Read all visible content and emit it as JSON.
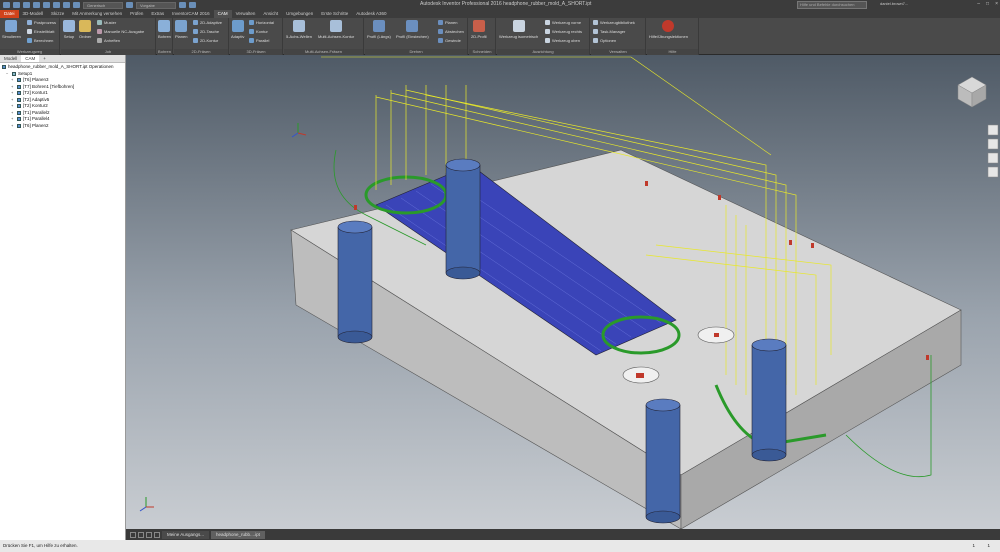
{
  "titlebar": {
    "style_value": "Generisch",
    "default_value": "Vorgabe",
    "title": "Autodesk Inventor Professional 2016    headphone_rubber_mold_A_SHORT.ipt",
    "search_placeholder": "Hilfe und Befehle durchsuchen",
    "user": "daniel.brown7...",
    "controls": [
      "–",
      "□",
      "×"
    ]
  },
  "tabs": [
    "Datei",
    "3D-Modell",
    "Skizze",
    "Mit Anmerkung versehen",
    "Prüfen",
    "Extras",
    "InventorCAM 2016",
    "CAM",
    "Verwalten",
    "Ansicht",
    "Umgebungen",
    "Erste Schritte",
    "Autodesk A360"
  ],
  "ribbon": {
    "werkzeugweg": {
      "label": "Werkzeugweg",
      "simulieren": "Simulieren",
      "postprozess": "Postprozess",
      "einstellblatt": "Einstellblatt",
      "berechnen": "Berechnen"
    },
    "job": {
      "label": "Job",
      "setup": "Setup",
      "ordner": "Ordner",
      "muster": "Muster",
      "manuelle": "Manuelle NC-Ausgabe",
      "anheften": "Anheften"
    },
    "bohren": {
      "label": "Bohren",
      "bohren": "Bohren"
    },
    "fraesen2d": {
      "label": "2D-Fräsen",
      "planen": "Planen",
      "adaptive": "2D-Adaptive",
      "tasche": "2D-Tasche",
      "kontur": "2D-Kontur"
    },
    "fraesen3d": {
      "label": "3D-Fräsen",
      "adaptiv": "Adaptiv",
      "horizontal": "Horizontal",
      "kontur": "Kontur",
      "parallel": "Parallel"
    },
    "multiachs": {
      "label": "Multi-Achsen-Fräsen",
      "wellen": "5-Achs-Wellen",
      "kontur": "Multi-Achsen-Kontur"
    },
    "drehen": {
      "label": "Drehen",
      "profil_l": "Profil (Längs)",
      "profil_e": "Profil (Einstechen)",
      "planen": "Planen",
      "abstechen": "Abstechen",
      "gewinde": "Gewinde"
    },
    "schneiden": {
      "label": "Schneiden",
      "profil": "2D-Profil"
    },
    "ausrichtung": {
      "label": "Ausrichtung",
      "isometrisch": "Werkzeug isometrisch",
      "vorne": "Werkzeug vorne",
      "rechts": "Werkzeug rechts",
      "oben": "Werkzeug oben"
    },
    "verwalten": {
      "label": "Verwalten",
      "bibliothek": "Werkzeugbibliothek",
      "task": "Task-Manager",
      "optionen": "Optionen"
    },
    "hilfe": {
      "label": "Hilfe",
      "hilfe": "Hilfe/Übungslektionen"
    }
  },
  "browser": {
    "tabs": [
      "Modell",
      "CAM",
      "+"
    ],
    "nodes": [
      "headphone_rubber_mold_A_SHORT.ipt Operationen",
      "Setup1",
      "[T6] Planen3",
      "[T7] Bohren1 [Tiefbohren]",
      "[T2] Kontur1",
      "[T2] Adaptiv5",
      "[T2] Kontur2",
      "[T1] Parallel2",
      "[T1] Parallel4",
      "[T6] Planen2"
    ]
  },
  "doctabs": [
    "Meine Ausgangs...",
    "headphone_rubb....ipt"
  ],
  "status": {
    "text": "Drücken Sie F1, um Hilfe zu erhalten.",
    "page1": "1",
    "page2": "1"
  }
}
